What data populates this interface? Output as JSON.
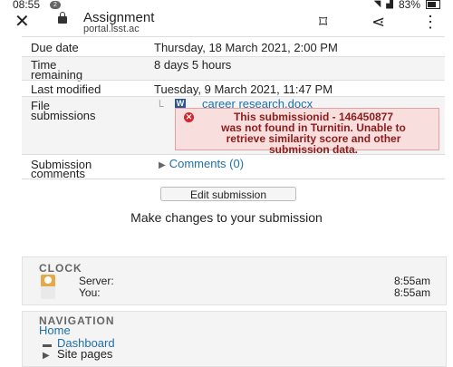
{
  "status_bar": {
    "time": "08:55",
    "notification_count": "2",
    "battery": "83%"
  },
  "app_bar": {
    "title": "Assignment",
    "url": "portal.lsst.ac",
    "icons": [
      "close-icon",
      "lock-icon",
      "bookmark-icon",
      "share-icon",
      "more-icon"
    ]
  },
  "details": {
    "due_date": {
      "label": "Due date",
      "value": "Thursday, 18 March 2021, 2:00 PM"
    },
    "time_remaining": {
      "label_line1": "Time",
      "label_line2": "remaining",
      "value": "8 days 5 hours"
    },
    "last_modified": {
      "label": "Last modified",
      "value": "Tuesday, 9 March 2021, 11:47 PM"
    },
    "file_submissions": {
      "label_line1": "File",
      "label_line2": "submissions",
      "file_icon_text": "W",
      "file_name": "career research.docx",
      "error_line1": "This submissionid - 146450877",
      "error_line2": "was not found in Turnitin. Unable to",
      "error_line3": "retrieve similarity score and other",
      "error_line4": "submission data."
    },
    "submission_comments": {
      "label_line1": "Submission",
      "label_line2": "comments",
      "link": "Comments (0)"
    }
  },
  "edit_button": "Edit submission",
  "hint": "Make changes to your submission",
  "clock": {
    "heading": "CLOCK",
    "server_label": "Server:",
    "server_time": "8:55am",
    "you_label": "You:",
    "you_time": "8:55am"
  },
  "navigation": {
    "heading": "NAVIGATION",
    "home": "Home",
    "dashboard": "Dashboard",
    "site_pages": "Site pages"
  },
  "colors": {
    "link": "#1f6fa8",
    "error_bg": "#f9dede",
    "error_text": "#8b1c1c"
  }
}
